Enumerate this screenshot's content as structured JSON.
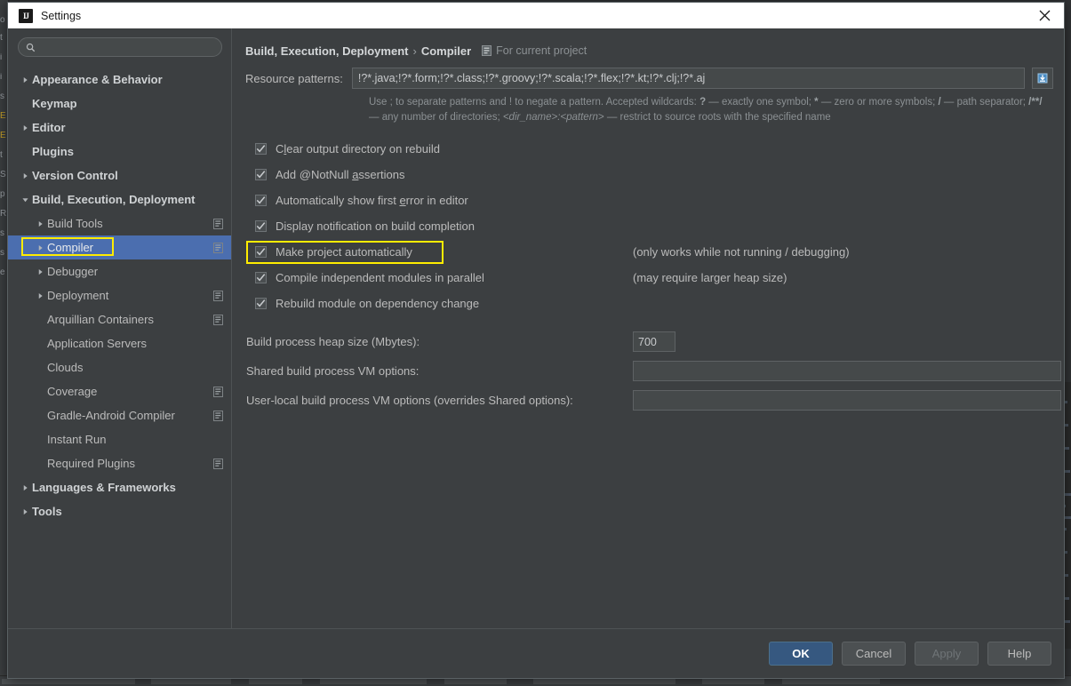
{
  "window": {
    "title": "Settings",
    "logo_icon": "intellij-idea-logo-icon",
    "close_icon": "close-icon"
  },
  "sidebar": {
    "search": {
      "value": "",
      "placeholder": "",
      "icon": "search-icon"
    },
    "items": [
      {
        "label": "Appearance & Behavior",
        "level": 0,
        "bold": true,
        "arrow": "collapsed",
        "scope_icon": false,
        "selected": false
      },
      {
        "label": "Keymap",
        "level": 0,
        "bold": true,
        "arrow": "none",
        "scope_icon": false,
        "selected": false
      },
      {
        "label": "Editor",
        "level": 0,
        "bold": true,
        "arrow": "collapsed",
        "scope_icon": false,
        "selected": false
      },
      {
        "label": "Plugins",
        "level": 0,
        "bold": true,
        "arrow": "none",
        "scope_icon": false,
        "selected": false
      },
      {
        "label": "Version Control",
        "level": 0,
        "bold": true,
        "arrow": "collapsed",
        "scope_icon": false,
        "selected": false
      },
      {
        "label": "Build, Execution, Deployment",
        "level": 0,
        "bold": true,
        "arrow": "expanded",
        "scope_icon": false,
        "selected": false
      },
      {
        "label": "Build Tools",
        "level": 1,
        "bold": false,
        "arrow": "collapsed",
        "scope_icon": true,
        "selected": false
      },
      {
        "label": "Compiler",
        "level": 1,
        "bold": false,
        "arrow": "collapsed",
        "scope_icon": true,
        "selected": true
      },
      {
        "label": "Debugger",
        "level": 1,
        "bold": false,
        "arrow": "collapsed",
        "scope_icon": false,
        "selected": false
      },
      {
        "label": "Deployment",
        "level": 1,
        "bold": false,
        "arrow": "collapsed",
        "scope_icon": true,
        "selected": false
      },
      {
        "label": "Arquillian Containers",
        "level": 1,
        "bold": false,
        "arrow": "none",
        "scope_icon": true,
        "selected": false
      },
      {
        "label": "Application Servers",
        "level": 1,
        "bold": false,
        "arrow": "none",
        "scope_icon": false,
        "selected": false
      },
      {
        "label": "Clouds",
        "level": 1,
        "bold": false,
        "arrow": "none",
        "scope_icon": false,
        "selected": false
      },
      {
        "label": "Coverage",
        "level": 1,
        "bold": false,
        "arrow": "none",
        "scope_icon": true,
        "selected": false
      },
      {
        "label": "Gradle-Android Compiler",
        "level": 1,
        "bold": false,
        "arrow": "none",
        "scope_icon": true,
        "selected": false
      },
      {
        "label": "Instant Run",
        "level": 1,
        "bold": false,
        "arrow": "none",
        "scope_icon": false,
        "selected": false
      },
      {
        "label": "Required Plugins",
        "level": 1,
        "bold": false,
        "arrow": "none",
        "scope_icon": true,
        "selected": false
      },
      {
        "label": "Languages & Frameworks",
        "level": 0,
        "bold": true,
        "arrow": "collapsed",
        "scope_icon": false,
        "selected": false
      },
      {
        "label": "Tools",
        "level": 0,
        "bold": true,
        "arrow": "collapsed",
        "scope_icon": false,
        "selected": false
      }
    ]
  },
  "main": {
    "breadcrumb": {
      "root": "Build, Execution, Deployment",
      "separator": "›",
      "current": "Compiler",
      "scope_icon": "project-scope-icon",
      "scope_text": "For current project"
    },
    "resource_patterns": {
      "label": "Resource patterns:",
      "value": "!?*.java;!?*.form;!?*.class;!?*.groovy;!?*.scala;!?*.flex;!?*.kt;!?*.clj;!?*.aj",
      "placeholder": "",
      "expand_icon": "expand-editor-icon"
    },
    "hint_line1_a": "Use ; to separate patterns and ! to negate a pattern. Accepted wildcards: ",
    "hint_q": "?",
    "hint_line1_b": " — exactly one symbol; ",
    "hint_star": "*",
    "hint_line1_c": " — zero or more symbols; ",
    "hint_slash": "/",
    "hint_line1_d": " —",
    "hint_line2_a": "path separator; ",
    "hint_globstar": "/**/",
    "hint_line2_b": " — any number of directories; ",
    "hint_dirname": "<dir_name>:<pattern>",
    "hint_line2_c": " — restrict to source roots with the specified name",
    "checkboxes": [
      {
        "label_pre": "C",
        "label_mn": "l",
        "label_post": "ear output directory on rebuild",
        "checked": true,
        "note": "",
        "highlighted": false
      },
      {
        "label_pre": "Add @NotNull ",
        "label_mn": "a",
        "label_post": "ssertions",
        "checked": true,
        "note": "",
        "highlighted": false
      },
      {
        "label_pre": "Automatically show first ",
        "label_mn": "e",
        "label_post": "rror in editor",
        "checked": true,
        "note": "",
        "highlighted": false
      },
      {
        "label_pre": "Display notification on build completion",
        "label_mn": "",
        "label_post": "",
        "checked": true,
        "note": "",
        "highlighted": false
      },
      {
        "label_pre": "Make project automatically",
        "label_mn": "",
        "label_post": "",
        "checked": true,
        "note": "(only works while not running / debugging)",
        "highlighted": true
      },
      {
        "label_pre": "Compile independent modules in parallel",
        "label_mn": "",
        "label_post": "",
        "checked": true,
        "note": "(may require larger heap size)",
        "highlighted": false
      },
      {
        "label_pre": "Rebuild module on dependency change",
        "label_mn": "",
        "label_post": "",
        "checked": true,
        "note": "",
        "highlighted": false
      }
    ],
    "fields": [
      {
        "label": "Build process heap size (Mbytes):",
        "value": "700",
        "placeholder": "",
        "size": "small"
      },
      {
        "label": "Shared build process VM options:",
        "value": "",
        "placeholder": "",
        "size": "wide"
      },
      {
        "label": "User-local build process VM options (overrides Shared options):",
        "value": "",
        "placeholder": "",
        "size": "wide"
      }
    ]
  },
  "footer": {
    "ok": "OK",
    "cancel": "Cancel",
    "apply": "Apply",
    "help": "Help"
  },
  "colors": {
    "accent_selected": "#4b6eaf",
    "primary_button": "#365880",
    "annotation": "#ffec00",
    "panel_bg": "#3c3f41",
    "field_bg": "#45494a",
    "text": "#bbbbbb"
  }
}
